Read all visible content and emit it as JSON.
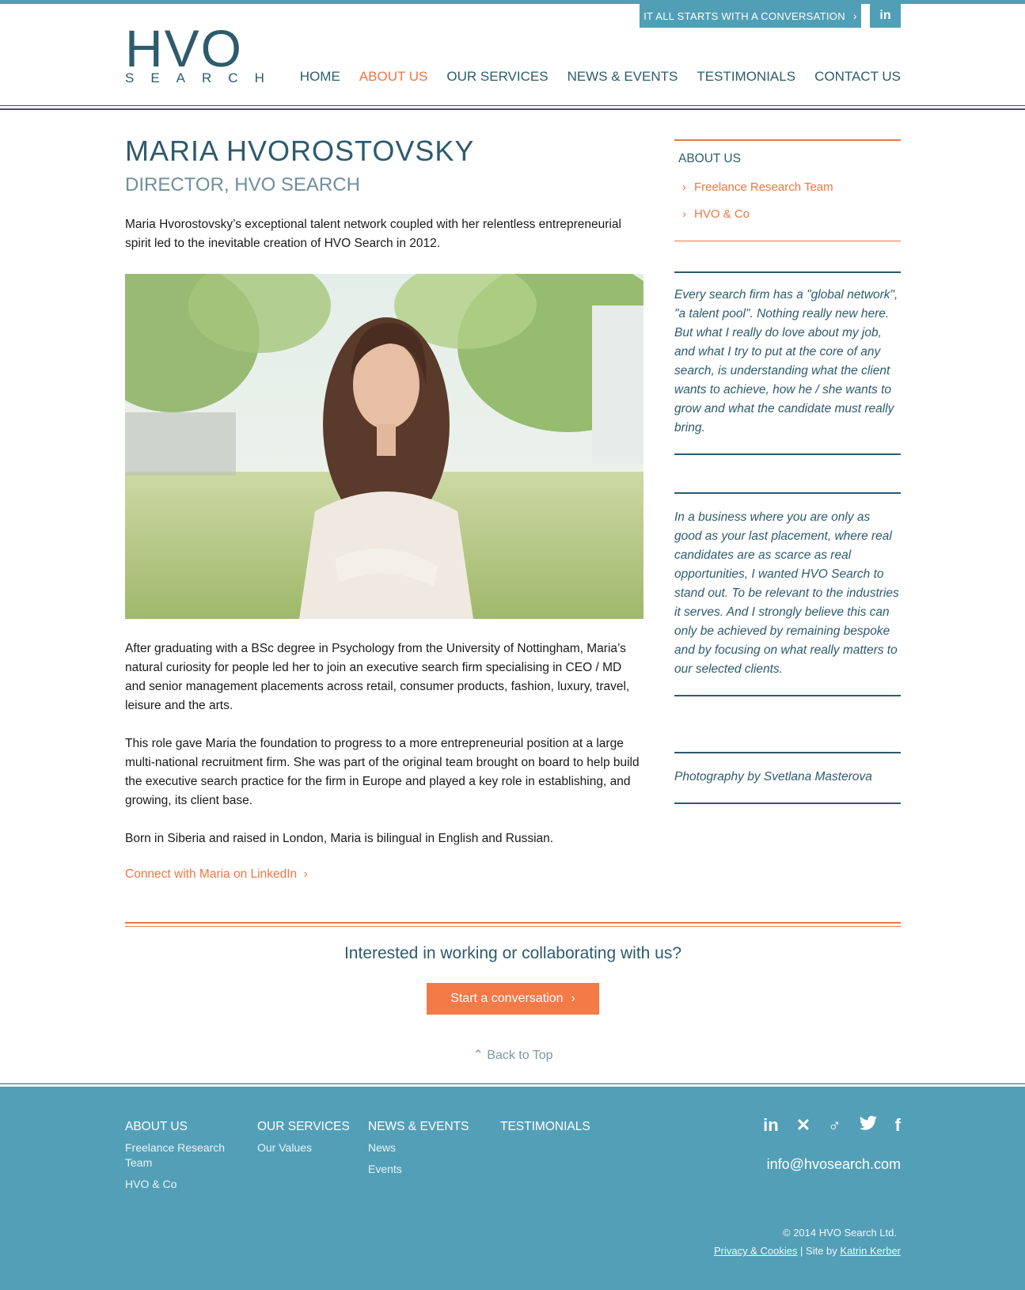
{
  "header": {
    "cta_label": "IT ALL STARTS WITH A CONVERSATION",
    "linkedin_label": "in",
    "logo_main": "HVO",
    "logo_sub": "SEARCH",
    "nav": [
      "HOME",
      "ABOUT US",
      "OUR SERVICES",
      "NEWS & EVENTS",
      "TESTIMONIALS",
      "CONTACT US"
    ],
    "active_nav": "ABOUT US"
  },
  "profile": {
    "name": "MARIA HVOROSTOVSKY",
    "role": "DIRECTOR, HVO SEARCH",
    "intro": "Maria Hvorostovsky’s exceptional talent network coupled with her relentless entrepreneurial spirit led to the inevitable creation of HVO Search in 2012.",
    "para1": "After graduating with a BSc degree in Psychology from the University of Nottingham, Maria’s natural curiosity for people led her to join an executive search firm specialising in CEO / MD and senior management placements across retail, consumer products, fashion, luxury, travel, leisure and the arts.",
    "para2": "This role gave Maria the foundation to progress to a more entrepreneurial position at a large multi-national recruitment firm. She was part of the original team brought on board to help build the executive search practice for the firm in Europe and played a key role in establishing, and growing, its client base.",
    "para3": "Born in Siberia and raised in London, Maria is bilingual in English and Russian.",
    "linkedin_link": "Connect with Maria on LinkedIn"
  },
  "sidebar": {
    "title": "ABOUT US",
    "items": [
      "Freelance Research Team",
      "HVO & Co"
    ],
    "quote1": "Every search firm has a \"global network\", \"a talent pool\". Nothing really new here. But what I really do love about my job, and what I try to put at the core of any search, is understanding what the client wants to achieve, how he / she wants to grow and what the candidate must really bring.",
    "quote2": "In a business where you are only as good as your last placement, where real candidates are as scarce as real opportunities, I wanted HVO Search to stand out. To be relevant to the industries it serves. And I strongly believe this can only be achieved by remaining bespoke and by focusing on what really matters to our selected clients.",
    "credit": "Photography by Svetlana Masterova"
  },
  "cta": {
    "question": "Interested in working or collaborating with us?",
    "button": "Start a conversation",
    "back_to_top": "Back to Top"
  },
  "footer": {
    "col1": {
      "head": "ABOUT US",
      "links": [
        "Freelance Research Team",
        "HVO & Co"
      ]
    },
    "col2": {
      "head": "OUR SERVICES",
      "links": [
        "Our Values"
      ]
    },
    "col3": {
      "head": "NEWS & EVENTS",
      "links": [
        "News",
        "Events"
      ]
    },
    "col4": {
      "head": "TESTIMONIALS"
    },
    "social": [
      "linkedin-icon",
      "xing-icon",
      "viadeo-icon",
      "twitter-icon",
      "facebook-icon"
    ],
    "email": "info@hvosearch.com",
    "copyright": "© 2014 HVO Search Ltd.",
    "privacy": "Privacy & Cookies",
    "separator": " | Site by ",
    "credit": "Katrin Kerber"
  },
  "colors": {
    "accent": "#ee7642",
    "brand": "#2d5b6c",
    "footer": "#539fb7"
  }
}
